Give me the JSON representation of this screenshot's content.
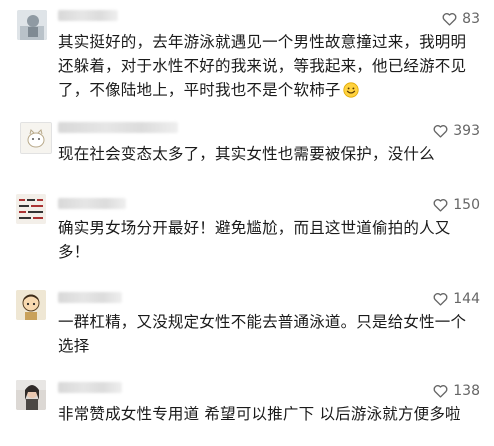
{
  "comments": [
    {
      "text": "其实挺好的，去年游泳就遇见一个男性故意撞过来，我明明还躲着，对于水性不好的我来说，等我起来，他已经游不见了，不像陆地上，平时我也不是个软柿子",
      "likes": "83",
      "emoji": "smiling-face-icon",
      "avatar": "avatar-photo-light"
    },
    {
      "text": "现在社会变态太多了，其实女性也需要被保护，没什么",
      "likes": "393",
      "avatar": "avatar-cartoon-cat"
    },
    {
      "text": "确实男女场分开最好！避免尴尬，而且这世道偷拍的人又多！",
      "likes": "150",
      "avatar": "avatar-text-image"
    },
    {
      "text": "一群杠精，又没规定女性不能去普通泳道。只是给女性一个选择",
      "likes": "144",
      "avatar": "avatar-cartoon-character"
    },
    {
      "text": "非常赞成女性专用道 希望可以推广下 以后游泳就方便多啦",
      "likes": "138",
      "avatar": "avatar-photo-person"
    }
  ],
  "colors": {
    "text": "#1a1a1a",
    "like_text": "#666666",
    "name_blur": "#dcdcdc"
  }
}
